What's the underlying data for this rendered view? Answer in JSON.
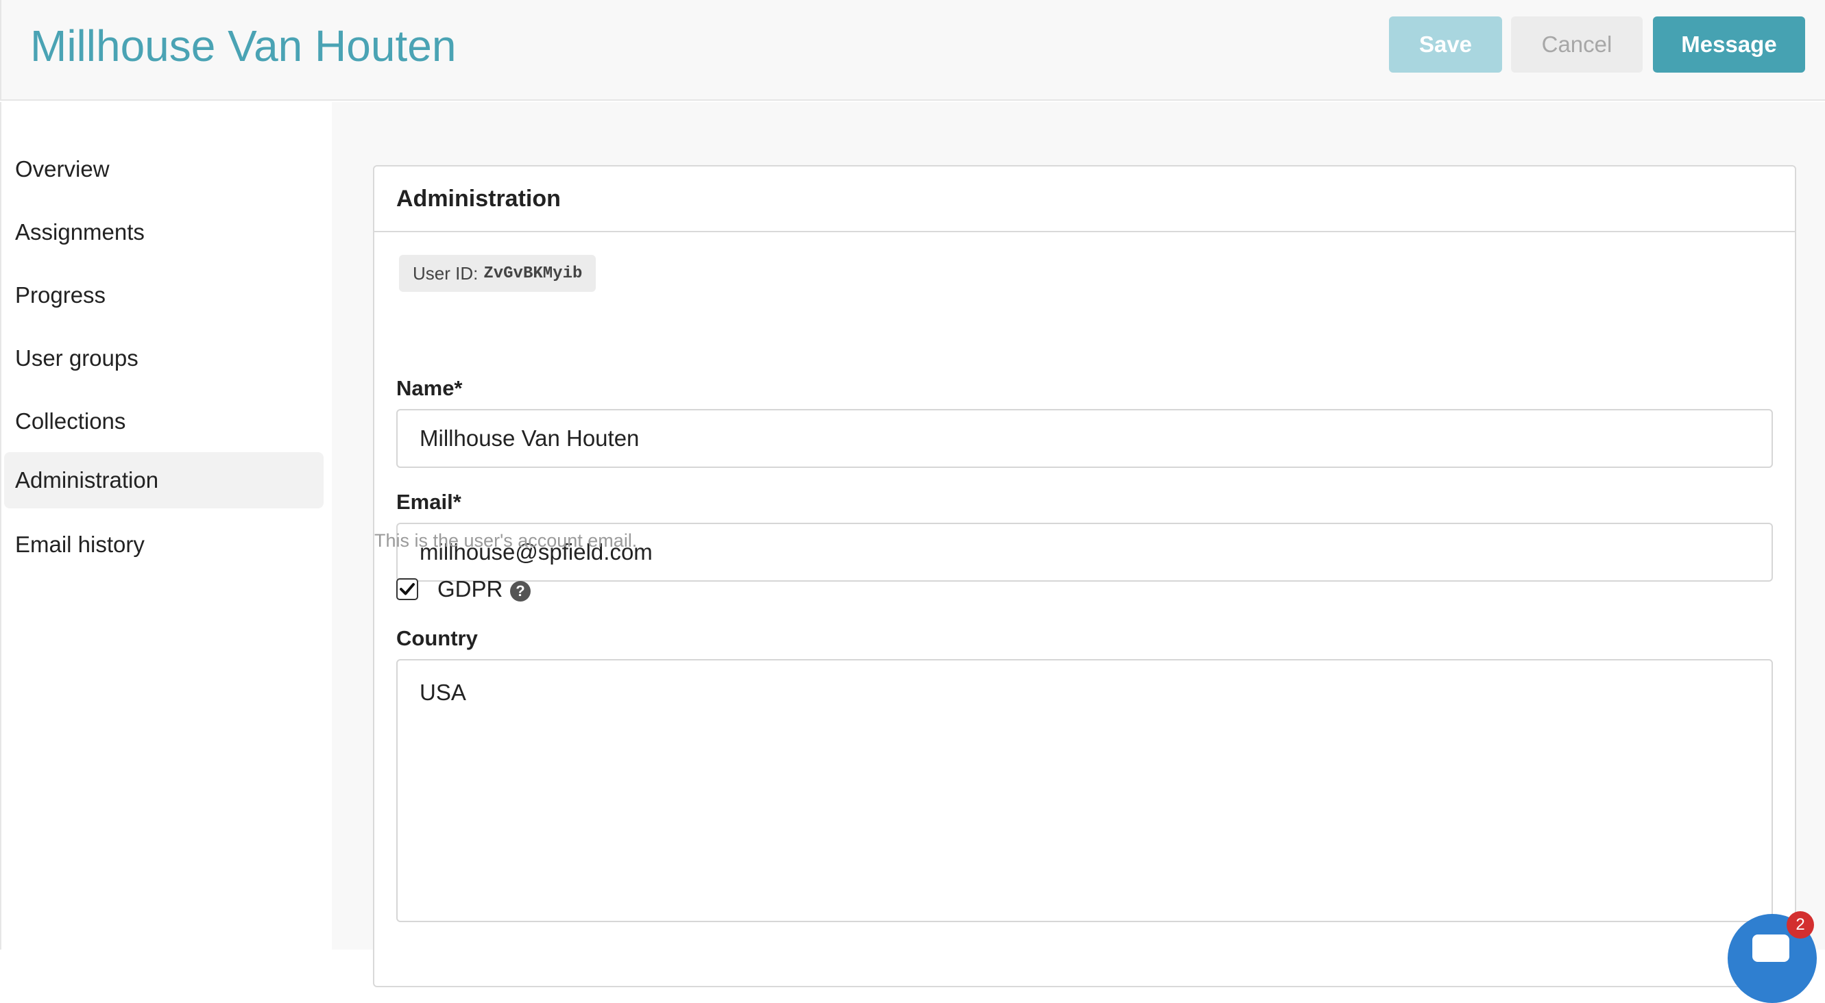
{
  "header": {
    "title": "Millhouse Van Houten",
    "buttons": {
      "save": "Save",
      "cancel": "Cancel",
      "message": "Message"
    }
  },
  "sidebar": {
    "items": [
      {
        "label": "Overview",
        "active": false
      },
      {
        "label": "Assignments",
        "active": false
      },
      {
        "label": "Progress",
        "active": false
      },
      {
        "label": "User groups",
        "active": false
      },
      {
        "label": "Collections",
        "active": false
      },
      {
        "label": "Administration",
        "active": true
      },
      {
        "label": "Email history",
        "active": false
      }
    ]
  },
  "admin": {
    "title": "Administration",
    "user_id_label": "User ID:",
    "user_id": "ZvGvBKMyib",
    "name_label": "Name*",
    "name_value": "Millhouse Van Houten",
    "email_label": "Email*",
    "email_value": "millhouse@spfield.com",
    "email_help": "This is the user's account email.",
    "gdpr_label": "GDPR",
    "gdpr_checked": true,
    "country_label": "Country",
    "country_value": "USA"
  },
  "chat_widget": {
    "badge_count": "2"
  },
  "colors": {
    "accent": "#46a2b2",
    "title": "#4aa3b4",
    "save_disabled": "#a9d6df",
    "badge": "#d32f2f",
    "chat": "#2f7fd0"
  },
  "icons": [
    "checkmark-icon",
    "question-circle-icon",
    "chat-icon"
  ]
}
